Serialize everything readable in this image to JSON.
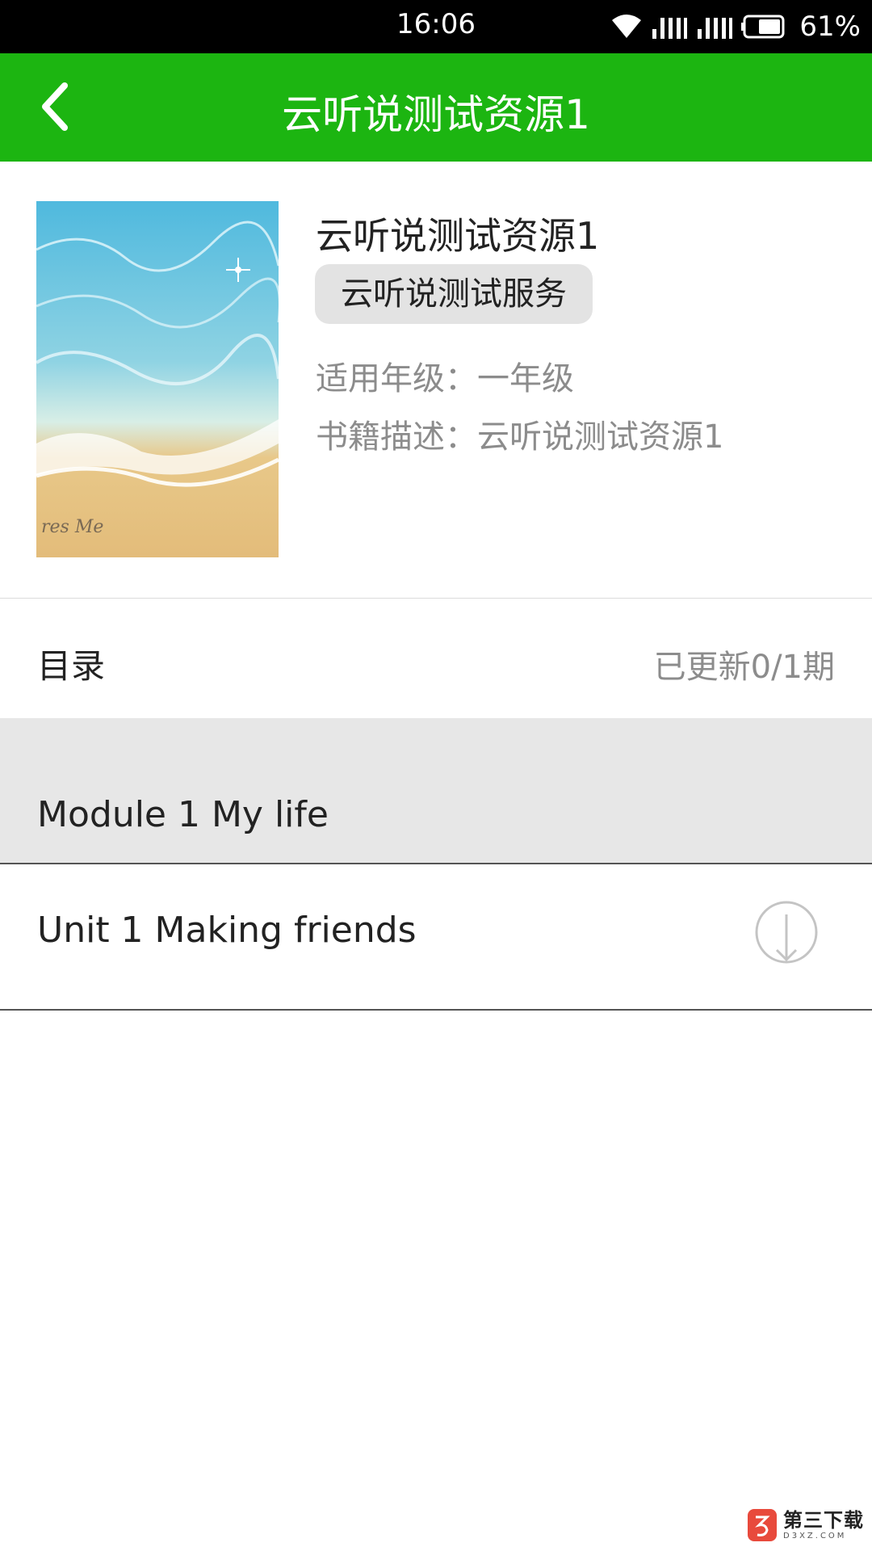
{
  "status_bar": {
    "time": "16:06",
    "battery": "61%",
    "icons": [
      "wifi-icon",
      "signal-icon",
      "signal-icon",
      "battery-icon"
    ]
  },
  "app_bar": {
    "back_icon": "chevron-left-icon",
    "title": "云听说测试资源1",
    "background_color": "#1cb511"
  },
  "book": {
    "cover_icon": "book-cover-image",
    "cover_text": "res Me",
    "title": "云听说测试资源1",
    "service_tag": "云听说测试服务",
    "grade_label": "适用年级：",
    "grade_value": "一年级",
    "desc_label": "书籍描述：",
    "desc_value": "云听说测试资源1"
  },
  "catalog": {
    "title": "目录",
    "update_status": "已更新0/1期"
  },
  "modules": [
    {
      "title": "Module 1 My life",
      "units": [
        {
          "title": "Unit 1 Making friends",
          "action_icon": "download-icon"
        }
      ]
    }
  ],
  "watermark": {
    "main": "第三下载",
    "sub": "D3XZ.COM",
    "icon": "download-logo-icon"
  }
}
